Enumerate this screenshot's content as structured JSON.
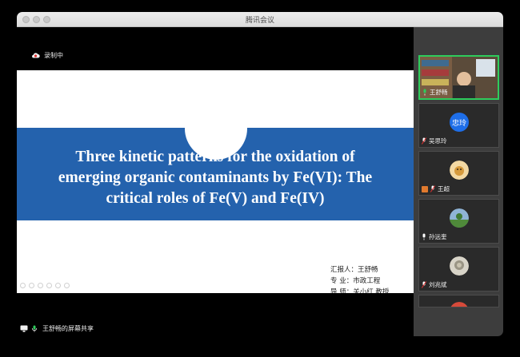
{
  "window": {
    "title": "腾讯会议"
  },
  "recording": {
    "label": "录制中"
  },
  "slide": {
    "title_lines": [
      "Three kinetic patterns for the oxidation of",
      "emerging organic contaminants by Fe(VI): The",
      "critical roles of Fe(V) and Fe(IV)"
    ],
    "info": [
      "汇报人：王舒畅",
      "专    业：市政工程",
      "导    师：关小红 教授"
    ]
  },
  "share": {
    "label": "王舒畅的屏幕共享"
  },
  "participants": [
    {
      "name": "王舒畅",
      "avatar": "video"
    },
    {
      "name": "吴思玲",
      "avatar": "text",
      "avatar_text": "忠玲"
    },
    {
      "name": "王超",
      "avatar": "image"
    },
    {
      "name": "孙远奎",
      "avatar": "image"
    },
    {
      "name": "刘兆斌",
      "avatar": "image"
    },
    {
      "name": "",
      "avatar": "image"
    }
  ],
  "colors": {
    "slide_band": "#2462ad",
    "active_speaker_border": "#2ecc5c",
    "avatar_blue": "#1e6ee8",
    "recording_icon": "#e03030"
  }
}
